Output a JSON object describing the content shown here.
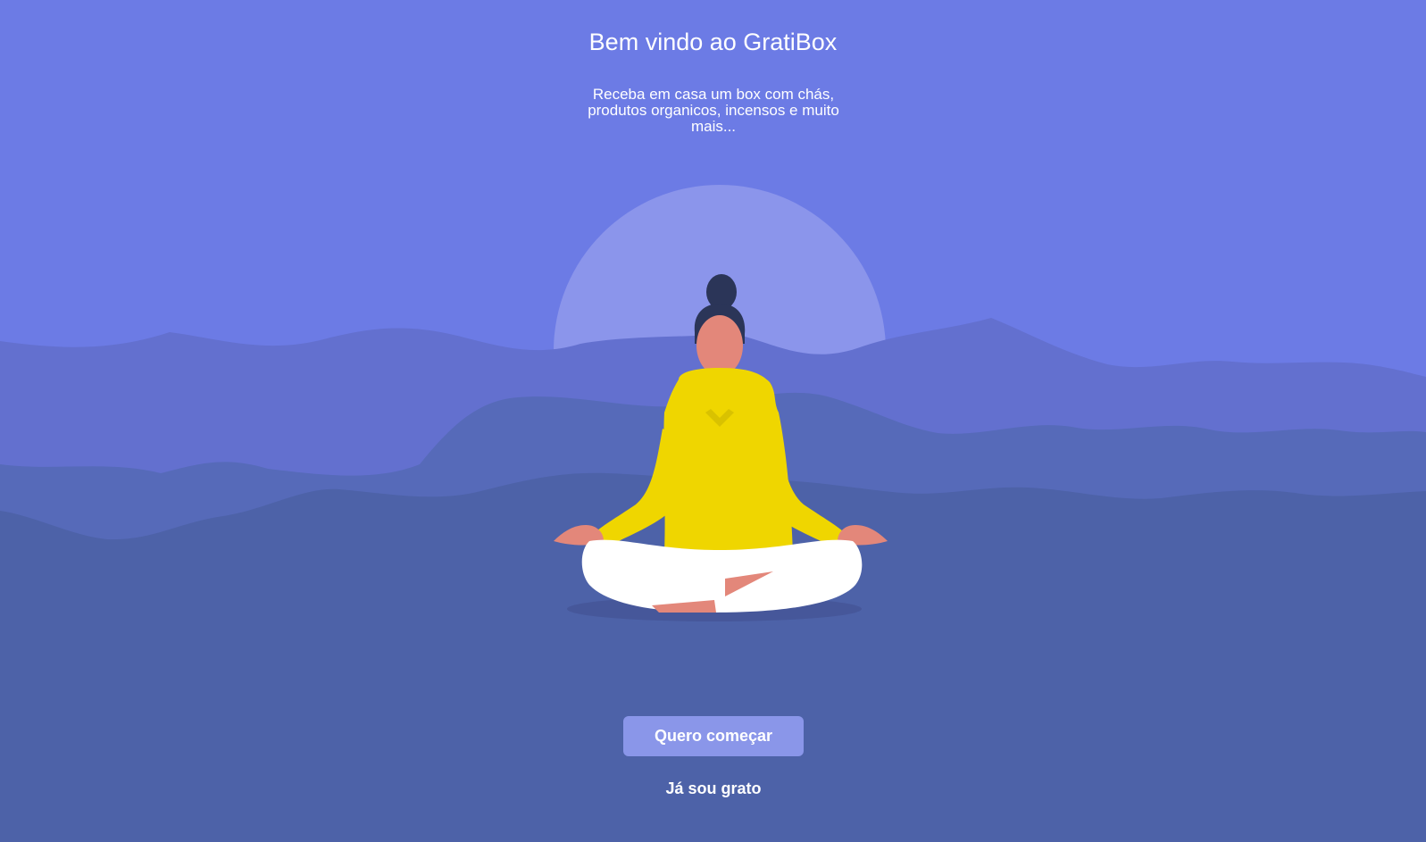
{
  "welcome": {
    "title": "Bem vindo ao GratiBox",
    "subtitle": "Receba em casa um box com chás, produtos organicos, incensos e muito mais..."
  },
  "illustration": {
    "name": "meditation-illustration",
    "colors": {
      "sky": "#6C7BE5",
      "moon": "#8B95EB",
      "mountains_back": "#6370CF",
      "mountains_mid": "#566AB9",
      "ground": "#4D62A8",
      "hoodie": "#EFD600",
      "skin": "#E3877A",
      "pants": "#FFFFFF",
      "hair": "#2B3558"
    }
  },
  "actions": {
    "start_label": "Quero começar",
    "login_label": "Já sou grato"
  },
  "colors": {
    "button_bg": "#8A96E9",
    "text": "#FFFFFF"
  }
}
